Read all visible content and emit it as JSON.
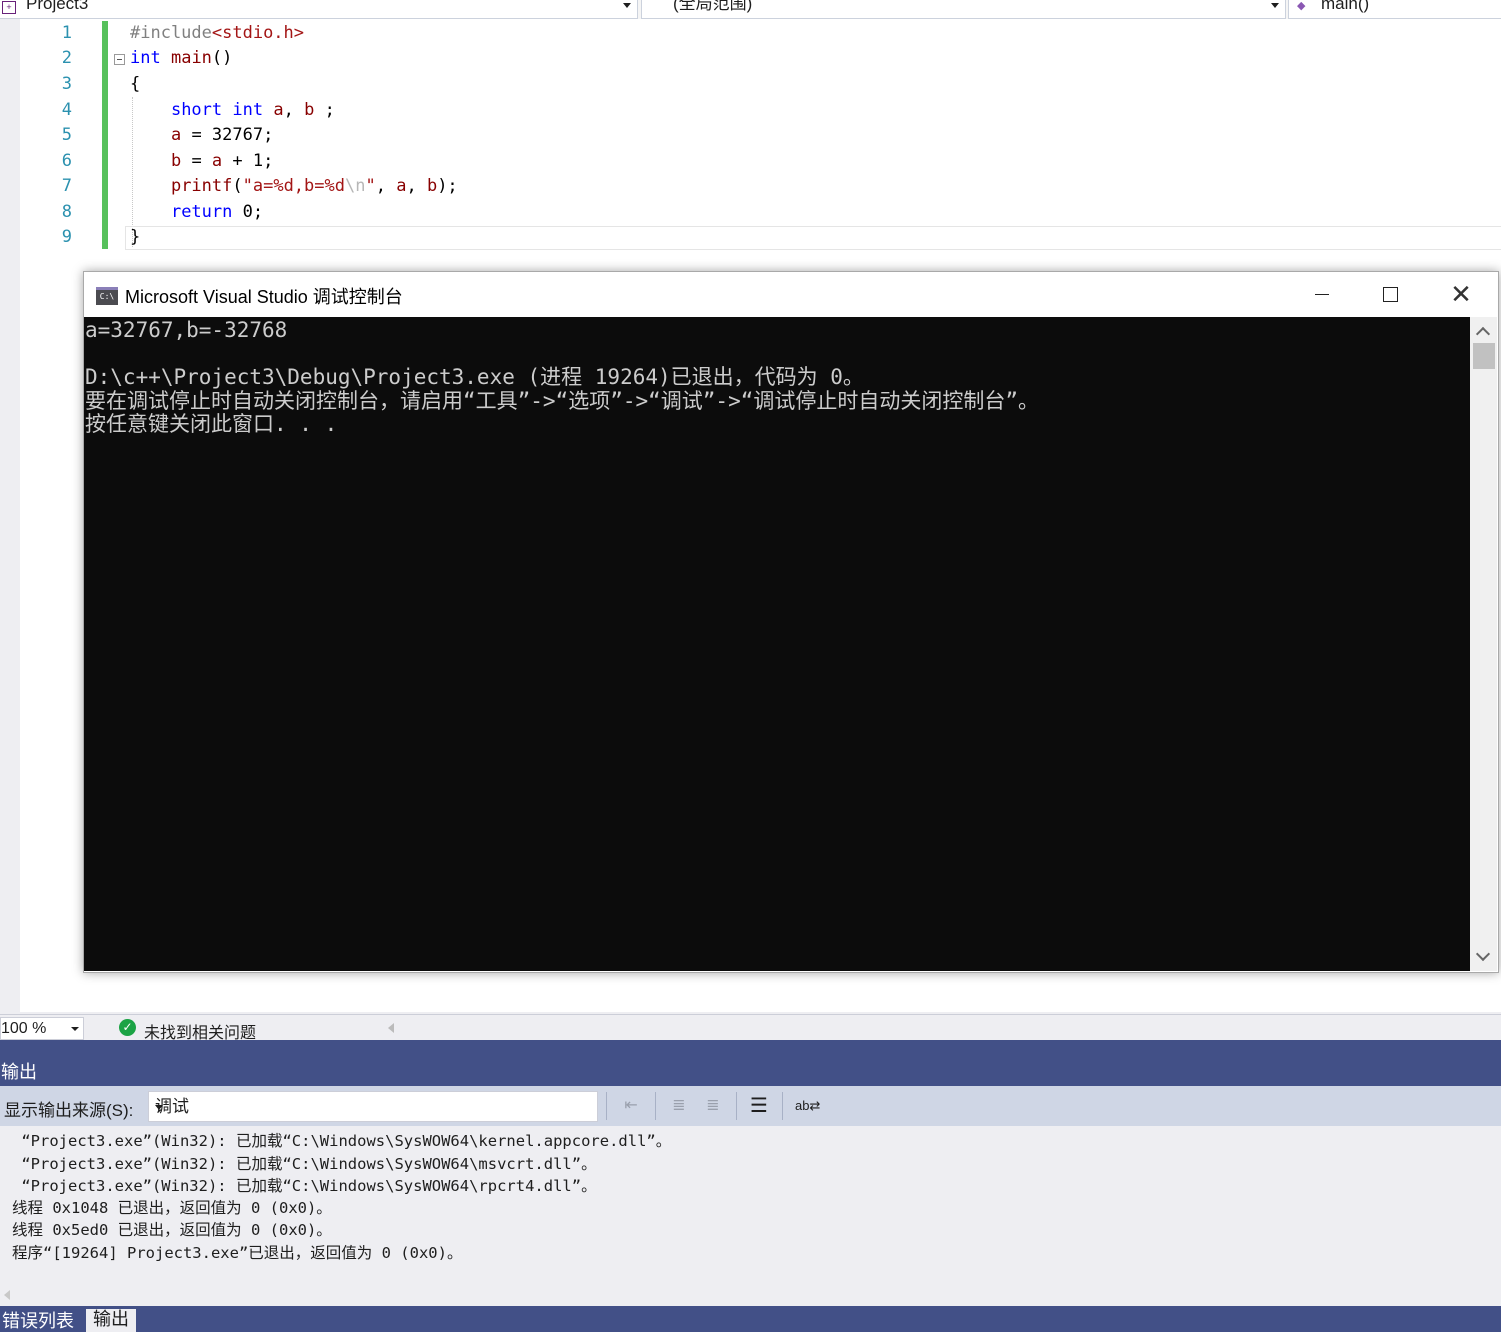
{
  "navbar": {
    "project": "Project3",
    "scope": "(全局范围)",
    "member": "main()"
  },
  "editor": {
    "line_numbers": [
      "1",
      "2",
      "3",
      "4",
      "5",
      "6",
      "7",
      "8",
      "9"
    ]
  },
  "console": {
    "title": "Microsoft Visual Studio 调试控制台",
    "icon_text": "C:\\",
    "lines": [
      "a=32767,b=-32768",
      "",
      "D:\\c++\\Project3\\Debug\\Project3.exe (进程 19264)已退出，代码为 0。",
      "要在调试停止时自动关闭控制台，请启用“工具”->“选项”->“调试”->“调试停止时自动关闭控制台”。",
      "按任意键关闭此窗口. . ."
    ]
  },
  "status": {
    "zoom": "100 %",
    "issues": "未找到相关问题"
  },
  "output": {
    "title": "输出",
    "source_label": "显示输出来源(S):",
    "source_value": "调试",
    "lines": [
      " “Project3.exe”(Win32): 已加载“C:\\Windows\\SysWOW64\\kernel.appcore.dll”。",
      " “Project3.exe”(Win32): 已加载“C:\\Windows\\SysWOW64\\msvcrt.dll”。",
      " “Project3.exe”(Win32): 已加载“C:\\Windows\\SysWOW64\\rpcrt4.dll”。",
      "线程 0x1048 已退出，返回值为 0 (0x0)。",
      "线程 0x5ed0 已退出，返回值为 0 (0x0)。",
      "程序“[19264] Project3.exe”已退出，返回值为 0 (0x0)。"
    ]
  },
  "tabs": {
    "errors": "错误列表",
    "output": "输出"
  },
  "colors": {
    "panel_header": "#425087",
    "toolbar": "#cfd6e5",
    "console_bg": "#0c0c0c",
    "change_bar": "#57c15c",
    "keyword": "#0000ff"
  }
}
